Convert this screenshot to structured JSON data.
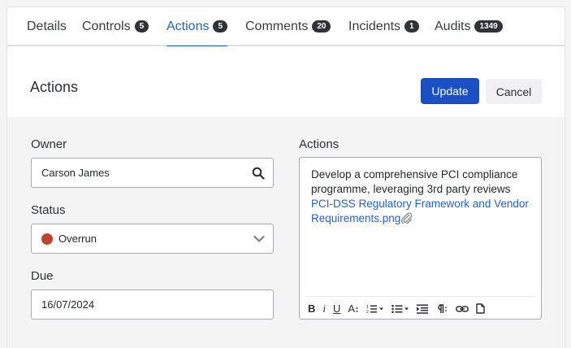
{
  "tabs": [
    {
      "label": "Details",
      "count": ""
    },
    {
      "label": "Controls",
      "count": "5"
    },
    {
      "label": "Actions",
      "count": "5"
    },
    {
      "label": "Comments",
      "count": "20"
    },
    {
      "label": "Incidents",
      "count": "1"
    },
    {
      "label": "Audits",
      "count": "1349"
    }
  ],
  "active_tab": "Actions",
  "panel": {
    "title": "Actions",
    "update_label": "Update",
    "cancel_label": "Cancel"
  },
  "form": {
    "owner": {
      "label": "Owner",
      "value": "Carson James",
      "icon": "search-icon"
    },
    "status": {
      "label": "Status",
      "value": "Overrun",
      "color": "#c0432e",
      "icon": "chevron-down-icon"
    },
    "due": {
      "label": "Due",
      "value": "16/07/2024"
    },
    "actions": {
      "label": "Actions",
      "text": "Develop a comprehensive PCI compliance programme, leveraging 3rd party reviews ",
      "link": "PCI-DSS Regulatory Framework and Vendor Requirements.png",
      "attachment_icon": "paperclip-icon"
    }
  },
  "toolbar": {
    "bold": "B",
    "italic": "i",
    "underline": "U",
    "font_size": "A",
    "icons": [
      "bold-icon",
      "italic-icon",
      "underline-icon",
      "font-size-icon",
      "ordered-list-icon",
      "bullet-list-icon",
      "indent-icon",
      "paragraph-icon",
      "link-icon",
      "document-icon"
    ]
  }
}
